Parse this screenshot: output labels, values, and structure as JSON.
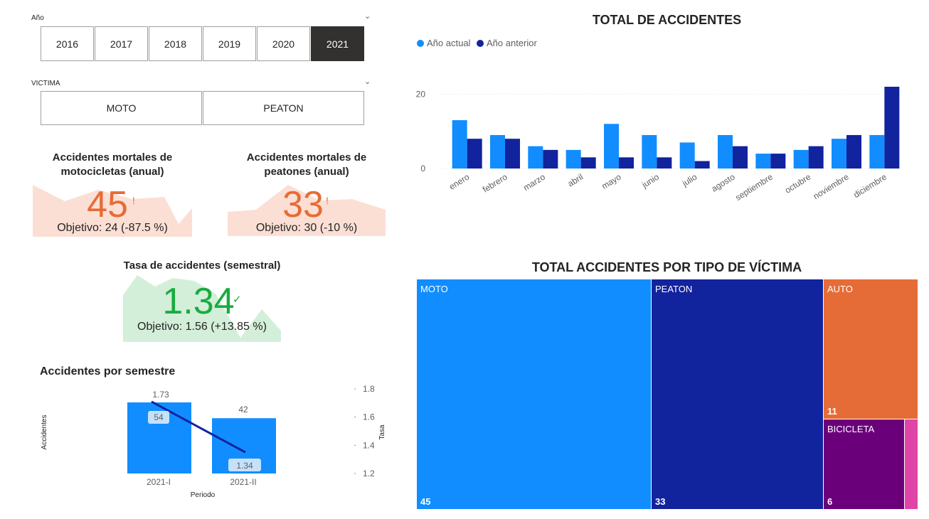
{
  "year_slicer": {
    "title": "Año",
    "options": [
      "2016",
      "2017",
      "2018",
      "2019",
      "2020",
      "2021"
    ],
    "selected": "2021"
  },
  "victim_slicer": {
    "title": "VICTIMA",
    "options": [
      "MOTO",
      "PEATON"
    ]
  },
  "kpi_moto": {
    "title_line1": "Accidentes mortales de",
    "title_line2": "motocicletas (anual)",
    "value": "45",
    "status": "!",
    "goal": "Objetivo: 24 (-87.5 %)",
    "color": "#e66c37"
  },
  "kpi_peaton": {
    "title_line1": "Accidentes mortales de",
    "title_line2": "peatones (anual)",
    "value": "33",
    "status": "!",
    "goal": "Objetivo: 30 (-10 %)",
    "color": "#e66c37"
  },
  "kpi_tasa": {
    "title": "Tasa de accidentes (semestral)",
    "value": "1.34",
    "status": "✓",
    "goal": "Objetivo: 1.56 (+13.85 %)",
    "color": "#1aab40"
  },
  "semester_chart": {
    "title": "Accidentes por semestre",
    "ylabel": "Accidentes",
    "y2label": "Tasa",
    "xlabel": "Periodo",
    "categories": [
      "2021-I",
      "2021-II"
    ],
    "bars": [
      54,
      42
    ],
    "rate": [
      1.73,
      1.34
    ],
    "bar_labels": [
      "54",
      "42"
    ],
    "rate_labels": [
      "1.73",
      "1.34"
    ],
    "y2_ticks": [
      "1.8",
      "1.6",
      "1.4",
      "1.2"
    ],
    "bar_color": "#118dff",
    "line_color": "#12239e"
  },
  "monthly_chart": {
    "title": "TOTAL DE ACCIDENTES",
    "legend": [
      {
        "name": "Año actual",
        "color": "#118dff"
      },
      {
        "name": "Año anterior",
        "color": "#12239e"
      }
    ],
    "y_ticks": [
      "20",
      "0"
    ]
  },
  "chart_data": [
    {
      "type": "bar",
      "title": "TOTAL DE ACCIDENTES",
      "categories": [
        "enero",
        "febrero",
        "marzo",
        "abril",
        "mayo",
        "junio",
        "julio",
        "agosto",
        "septiembre",
        "octubre",
        "noviembre",
        "diciembre"
      ],
      "series": [
        {
          "name": "Año actual",
          "values": [
            13,
            9,
            6,
            5,
            12,
            9,
            7,
            9,
            4,
            5,
            8,
            9
          ]
        },
        {
          "name": "Año anterior",
          "values": [
            8,
            8,
            5,
            3,
            3,
            3,
            2,
            6,
            4,
            6,
            9,
            22
          ]
        }
      ],
      "ylim": [
        0,
        22
      ]
    },
    {
      "type": "bar",
      "title": "Accidentes por semestre",
      "xlabel": "Periodo",
      "ylabel": "Accidentes",
      "categories": [
        "2021-I",
        "2021-II"
      ],
      "series": [
        {
          "name": "Accidentes",
          "values": [
            54,
            42
          ]
        },
        {
          "name": "Tasa",
          "values": [
            1.73,
            1.34
          ]
        }
      ]
    }
  ],
  "treemap": {
    "title": "TOTAL ACCIDENTES POR TIPO DE VÍCTIMA",
    "items": [
      {
        "name": "MOTO",
        "value": "45",
        "color": "#118dff"
      },
      {
        "name": "PEATON",
        "value": "33",
        "color": "#12239e"
      },
      {
        "name": "AUTO",
        "value": "11",
        "color": "#e66c37"
      },
      {
        "name": "BICICLETA",
        "value": "6",
        "color": "#6b007b"
      },
      {
        "name": "",
        "value": "",
        "color": "#e044a7"
      }
    ]
  }
}
